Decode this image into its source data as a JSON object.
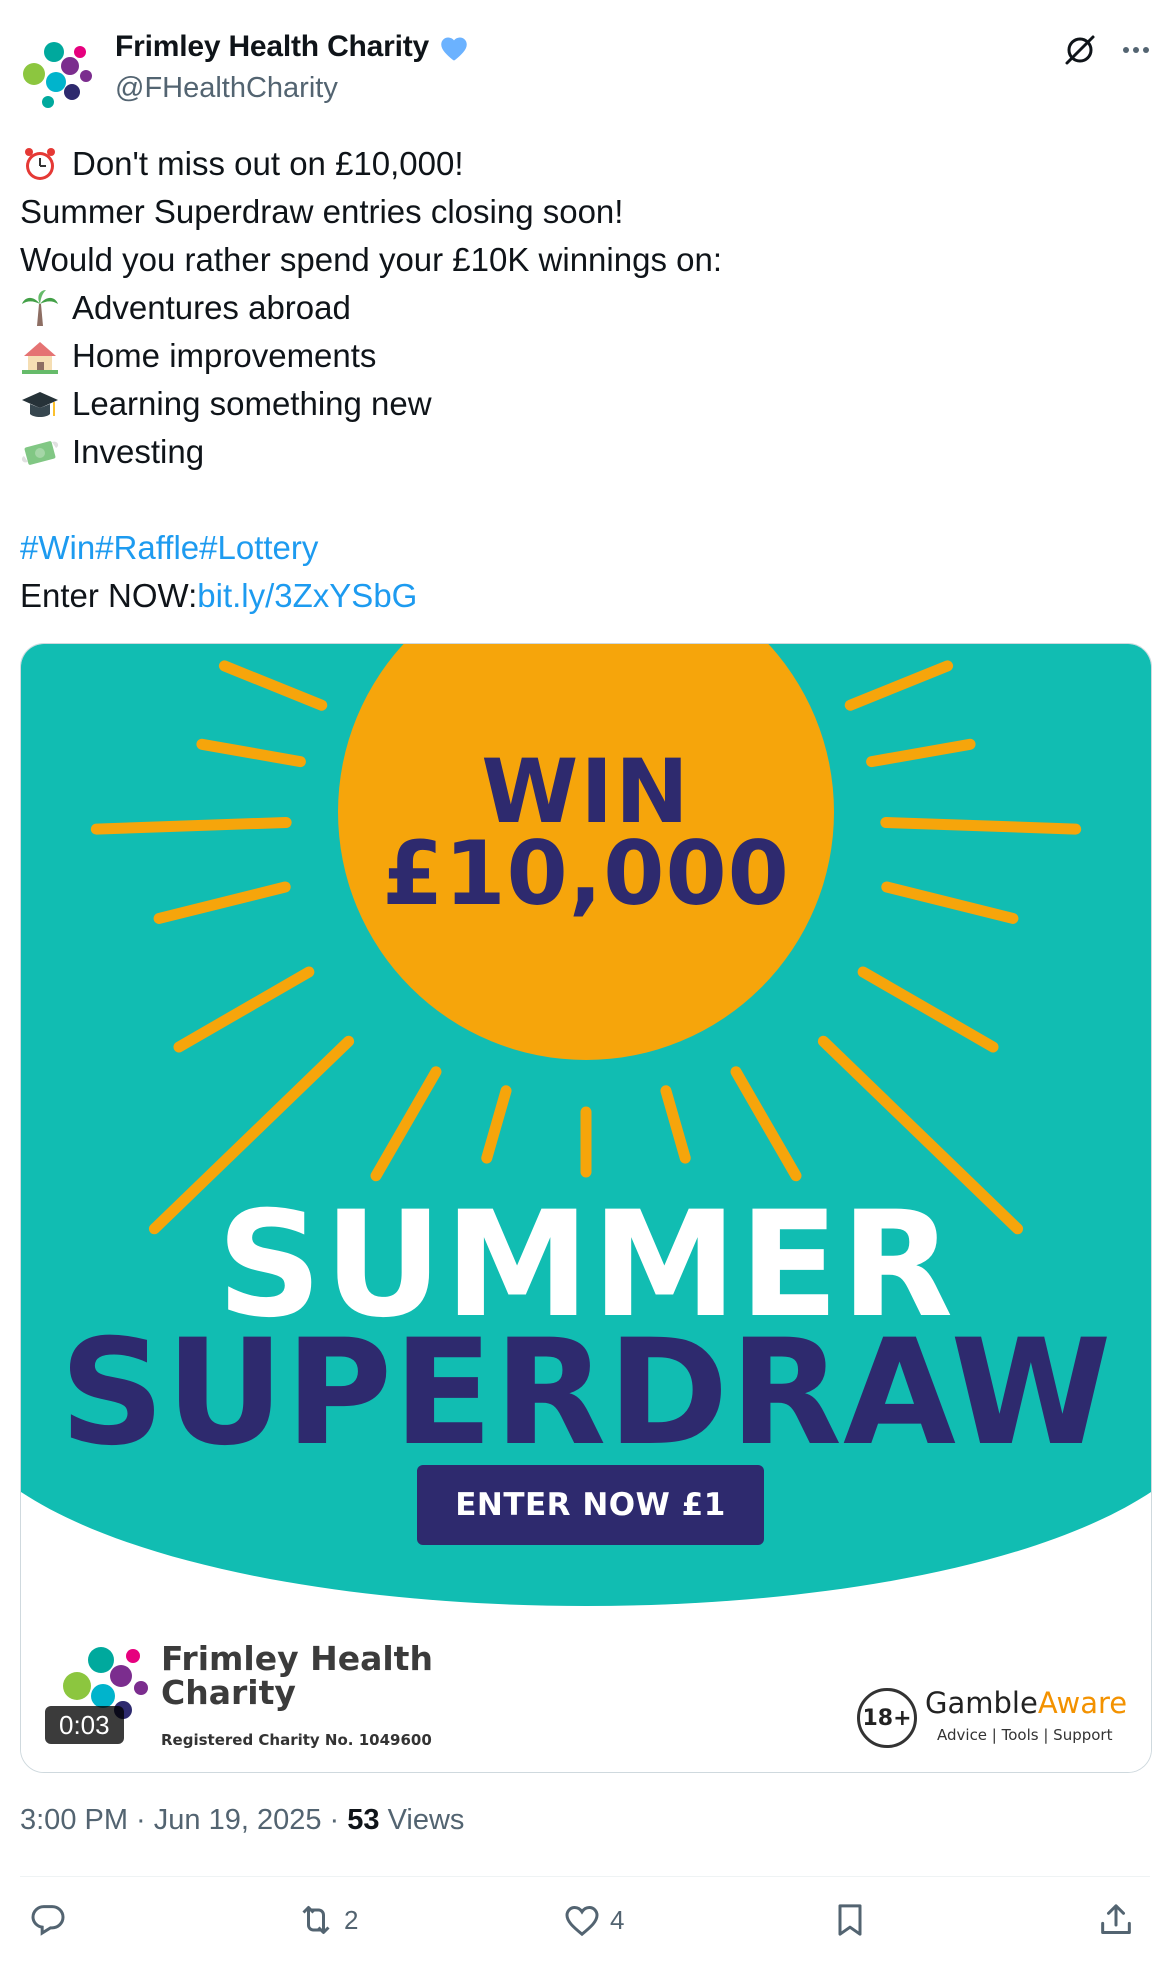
{
  "author": {
    "display_name": "Frimley Health Charity",
    "handle": "@FHealthCharity",
    "verified": true
  },
  "tweet": {
    "lines": [
      {
        "icon": "alarm-clock-emoji",
        "text": "Don't miss out on £10,000!"
      },
      {
        "icon": "",
        "text": "Summer Superdraw entries closing soon!"
      },
      {
        "icon": "",
        "text": "Would you rather spend your £10K winnings on:"
      },
      {
        "icon": "palm-tree-emoji",
        "text": "Adventures abroad"
      },
      {
        "icon": "house-garden-emoji",
        "text": "Home improvements"
      },
      {
        "icon": "graduation-cap-emoji",
        "text": "Learning something new"
      },
      {
        "icon": "money-wings-emoji",
        "text": "Investing"
      }
    ],
    "hashtags": [
      "#Win",
      "#Raffle",
      "#Lottery"
    ],
    "enter_label": "Enter NOW:",
    "enter_link": "bit.ly/3ZxYSbG"
  },
  "media": {
    "win_line": "WIN",
    "amount_line": "£10,000",
    "summer": "SUMMER",
    "superdraw": "SUPERDRAW",
    "cta": "ENTER NOW £1",
    "brand_line1": "Frimley Health",
    "brand_line2": "Charity",
    "reg_no": "Registered Charity No. 1049600",
    "age_badge": "18+",
    "ga_gamble": "Gamble",
    "ga_aware": "Aware",
    "ga_sub": "Advice | Tools | Support",
    "duration": "0:03",
    "colors": {
      "teal": "#11bdb2",
      "sun": "#f6a50b",
      "navy": "#2e2a6e"
    }
  },
  "meta": {
    "time_date": "3:00 PM · Jun 19, 2025 · ",
    "views_count": "53",
    "views_label": " Views"
  },
  "actions": {
    "reply_count": "",
    "retweet_count": "2",
    "like_count": "4"
  },
  "colors": {
    "link": "#1d9bf0",
    "secondary": "#536471"
  }
}
